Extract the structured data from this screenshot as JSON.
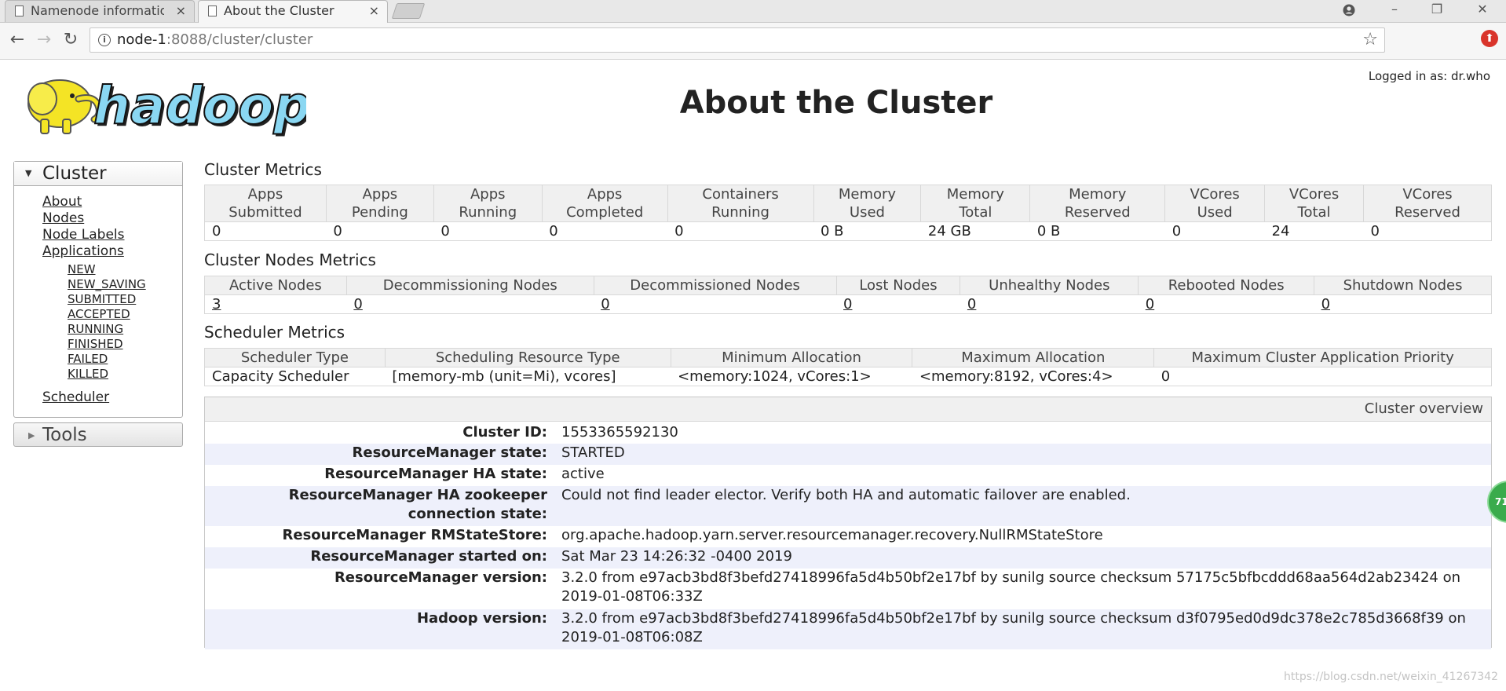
{
  "browser": {
    "tabs": [
      {
        "title": "Namenode information",
        "close": "×"
      },
      {
        "title": "About the Cluster",
        "close": "×"
      }
    ],
    "url_host": "node-1",
    "url_rest": ":8088/cluster/cluster",
    "window_controls": {
      "minimize": "–",
      "restore": "❐",
      "close": "✕"
    }
  },
  "header": {
    "title": "About the Cluster",
    "logged_in": "Logged in as: dr.who",
    "logo_text": "hadoop"
  },
  "sidebar": {
    "cluster_label": "Cluster",
    "items": [
      "About",
      "Nodes",
      "Node Labels",
      "Applications"
    ],
    "app_states": [
      "NEW",
      "NEW_SAVING",
      "SUBMITTED",
      "ACCEPTED",
      "RUNNING",
      "FINISHED",
      "FAILED",
      "KILLED"
    ],
    "scheduler": "Scheduler",
    "tools_label": "Tools"
  },
  "cluster_metrics": {
    "title": "Cluster Metrics",
    "headers": [
      [
        "Apps",
        "Submitted"
      ],
      [
        "Apps",
        "Pending"
      ],
      [
        "Apps",
        "Running"
      ],
      [
        "Apps",
        "Completed"
      ],
      [
        "Containers",
        "Running"
      ],
      [
        "Memory",
        "Used"
      ],
      [
        "Memory",
        "Total"
      ],
      [
        "Memory",
        "Reserved"
      ],
      [
        "VCores",
        "Used"
      ],
      [
        "VCores",
        "Total"
      ],
      [
        "VCores",
        "Reserved"
      ]
    ],
    "values": [
      "0",
      "0",
      "0",
      "0",
      "0",
      "0 B",
      "24 GB",
      "0 B",
      "0",
      "24",
      "0"
    ]
  },
  "node_metrics": {
    "title": "Cluster Nodes Metrics",
    "headers": [
      "Active Nodes",
      "Decommissioning Nodes",
      "Decommissioned Nodes",
      "Lost Nodes",
      "Unhealthy Nodes",
      "Rebooted Nodes",
      "Shutdown Nodes"
    ],
    "values": [
      "3",
      "0",
      "0",
      "0",
      "0",
      "0",
      "0"
    ]
  },
  "scheduler_metrics": {
    "title": "Scheduler Metrics",
    "headers": [
      "Scheduler Type",
      "Scheduling Resource Type",
      "Minimum Allocation",
      "Maximum Allocation",
      "Maximum Cluster Application Priority"
    ],
    "values": [
      "Capacity Scheduler",
      "[memory-mb (unit=Mi), vcores]",
      "<memory:1024, vCores:1>",
      "<memory:8192, vCores:4>",
      "0"
    ]
  },
  "overview": {
    "title": "Cluster overview",
    "rows": [
      {
        "key": "Cluster ID:",
        "value": "1553365592130"
      },
      {
        "key": "ResourceManager state:",
        "value": "STARTED"
      },
      {
        "key": "ResourceManager HA state:",
        "value": "active"
      },
      {
        "key": "ResourceManager HA zookeeper connection state:",
        "value": "Could not find leader elector. Verify both HA and automatic failover are enabled."
      },
      {
        "key": "ResourceManager RMStateStore:",
        "value": "org.apache.hadoop.yarn.server.resourcemanager.recovery.NullRMStateStore"
      },
      {
        "key": "ResourceManager started on:",
        "value": "Sat Mar 23 14:26:32 -0400 2019"
      },
      {
        "key": "ResourceManager version:",
        "value": "3.2.0 from e97acb3bd8f3befd27418996fa5d4b50bf2e17bf by sunilg source checksum 57175c5bfbcddd68aa564d2ab23424 on 2019-01-08T06:33Z"
      },
      {
        "key": "Hadoop version:",
        "value": "3.2.0 from e97acb3bd8f3befd27418996fa5d4b50bf2e17bf by sunilg source checksum d3f0795ed0d9dc378e2c785d3668f39 on 2019-01-08T06:08Z"
      }
    ]
  },
  "overlay": {
    "badge": "71"
  },
  "watermark": "https://blog.csdn.net/weixin_41267342"
}
